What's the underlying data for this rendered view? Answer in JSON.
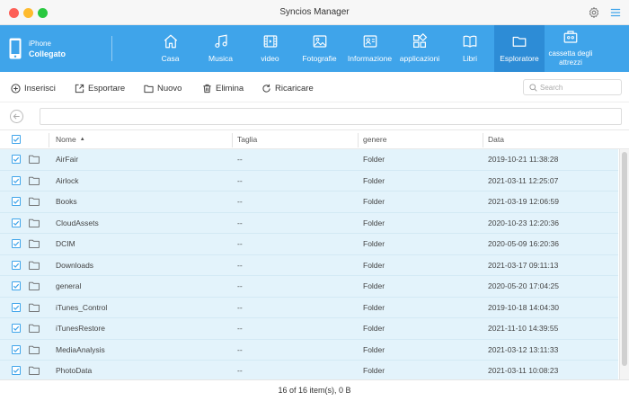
{
  "window": {
    "title": "Syncios Manager",
    "icons": [
      "settings-gear-icon",
      "menu-icon"
    ]
  },
  "device": {
    "name": "iPhone",
    "status": "Collegato",
    "icon": "phone-icon"
  },
  "nav": [
    {
      "id": "home",
      "label": "Casa",
      "icon": "home-icon"
    },
    {
      "id": "music",
      "label": "Musica",
      "icon": "music-note-icon"
    },
    {
      "id": "video",
      "label": "video",
      "icon": "film-icon"
    },
    {
      "id": "photos",
      "label": "Fotografie",
      "icon": "image-icon"
    },
    {
      "id": "info",
      "label": "Informazione",
      "icon": "contact-card-icon"
    },
    {
      "id": "apps",
      "label": "applicazioni",
      "icon": "apps-grid-icon"
    },
    {
      "id": "books",
      "label": "Libri",
      "icon": "book-icon"
    },
    {
      "id": "explorer",
      "label": "Esploratore",
      "icon": "folder-icon",
      "active": true
    },
    {
      "id": "toolbox",
      "label": "cassetta degli attrezzi",
      "icon": "toolbox-icon"
    }
  ],
  "colors": {
    "header": "#3fa4ea",
    "header_active": "#2d8cd6",
    "row_selected": "#e3f3fb",
    "checkbox": "#3fa4ea"
  },
  "toolbar": {
    "import_label": "Inserisci",
    "export_label": "Esportare",
    "new_label": "Nuovo",
    "delete_label": "Elimina",
    "reload_label": "Ricaricare",
    "search_placeholder": "Search"
  },
  "path": {
    "value": ""
  },
  "table": {
    "columns": {
      "name": "Nome",
      "size": "Taglia",
      "type": "genere",
      "date": "Data"
    },
    "sort_column": "name",
    "sort_direction": "asc",
    "rows": [
      {
        "name": "AirFair",
        "size": "--",
        "type": "Folder",
        "date": "2019-10-21 11:38:28"
      },
      {
        "name": "Airlock",
        "size": "--",
        "type": "Folder",
        "date": "2021-03-11 12:25:07"
      },
      {
        "name": "Books",
        "size": "--",
        "type": "Folder",
        "date": "2021-03-19 12:06:59"
      },
      {
        "name": "CloudAssets",
        "size": "--",
        "type": "Folder",
        "date": "2020-10-23 12:20:36"
      },
      {
        "name": "DCIM",
        "size": "--",
        "type": "Folder",
        "date": "2020-05-09 16:20:36"
      },
      {
        "name": "Downloads",
        "size": "--",
        "type": "Folder",
        "date": "2021-03-17 09:11:13"
      },
      {
        "name": "general",
        "size": "--",
        "type": "Folder",
        "date": "2020-05-20 17:04:25"
      },
      {
        "name": "iTunes_Control",
        "size": "--",
        "type": "Folder",
        "date": "2019-10-18 14:04:30"
      },
      {
        "name": "iTunesRestore",
        "size": "--",
        "type": "Folder",
        "date": "2021-11-10 14:39:55"
      },
      {
        "name": "MediaAnalysis",
        "size": "--",
        "type": "Folder",
        "date": "2021-03-12 13:11:33"
      },
      {
        "name": "PhotoData",
        "size": "--",
        "type": "Folder",
        "date": "2021-03-11 10:08:23"
      }
    ]
  },
  "footer": {
    "status": "16 of 16 item(s), 0 B"
  }
}
